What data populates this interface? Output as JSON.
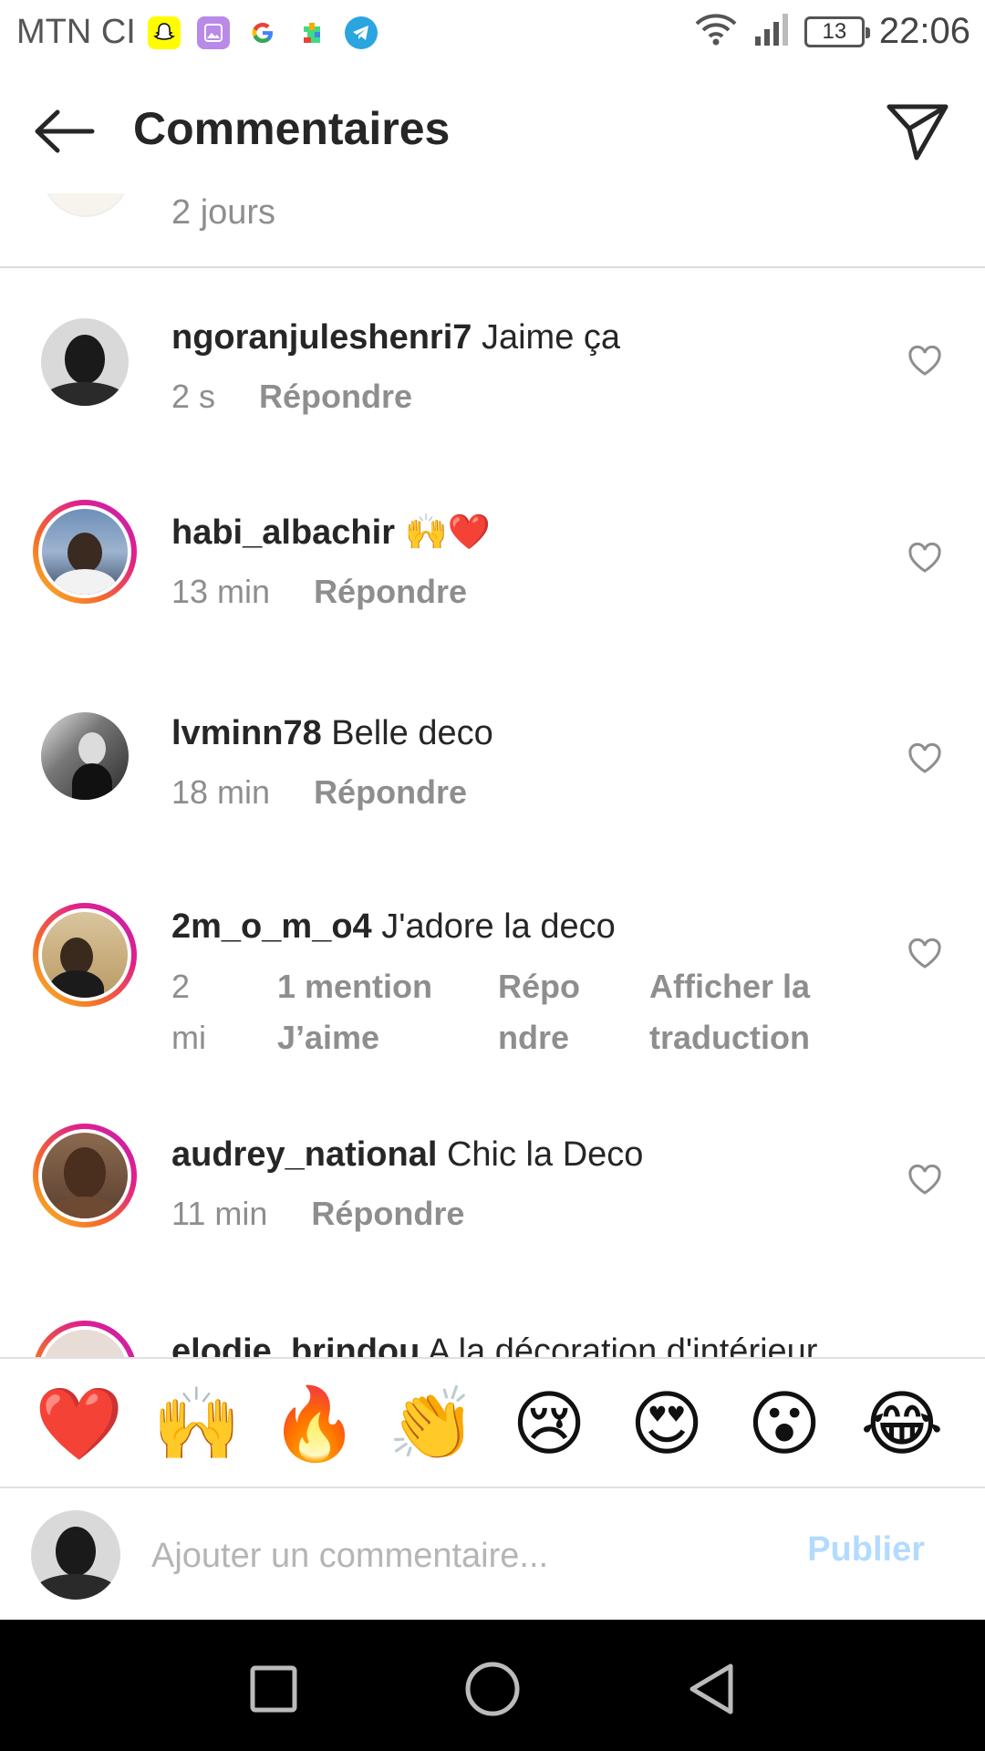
{
  "status_bar": {
    "carrier": "MTN CI",
    "battery": "13",
    "time": "22:06",
    "app_icons": [
      "snapchat-icon",
      "gallery-icon",
      "google-icon",
      "play-games-icon",
      "telegram-icon"
    ]
  },
  "header": {
    "title": "Commentaires"
  },
  "partial_comment": {
    "time": "2 jours"
  },
  "comments": [
    {
      "username": "ngoranjuleshenri7",
      "text": "Jaime ça",
      "time": "2 s",
      "reply": "Répondre"
    },
    {
      "username": "habi_albachir",
      "text": "🙌❤️",
      "time": "13 min",
      "reply": "Répondre"
    },
    {
      "username": "lvminn78",
      "text": "Belle deco",
      "time": "18 min",
      "reply": "Répondre"
    },
    {
      "username": "2m_o_m_o4",
      "text": "J'adore la deco",
      "time": "2 mi",
      "likes": "1 mention J’aime",
      "reply": "Répo ndre",
      "translate": "Afficher la traduction"
    },
    {
      "username": "audrey_national",
      "text": "Chic la Deco",
      "time": "11 min",
      "reply": "Répondre"
    },
    {
      "username": "elodie_brindou",
      "text": "A la décoration d'intérieur"
    }
  ],
  "emoji_bar": [
    "❤️",
    "🙌",
    "🔥",
    "👏",
    "😢",
    "😍",
    "😮",
    "😂"
  ],
  "composer": {
    "placeholder": "Ajouter un commentaire...",
    "publish_label": "Publier"
  },
  "colors": {
    "primary_text": "#262626",
    "secondary_text": "#8e8e8e",
    "publish_disabled": "#b3dbff",
    "divider": "#dbdbdb"
  }
}
